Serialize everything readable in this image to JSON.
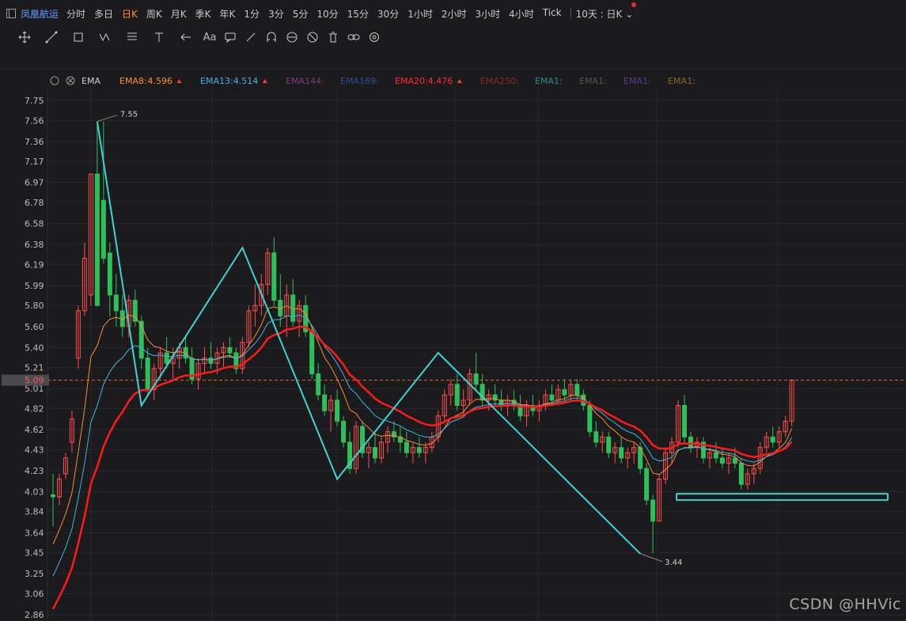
{
  "header": {
    "stock_name": "凤凰航运",
    "periods": [
      "分时",
      "多日",
      "日K",
      "周K",
      "月K",
      "季K",
      "年K",
      "1分",
      "3分",
      "5分",
      "10分",
      "15分",
      "30分",
      "1小时",
      "2小时",
      "3小时",
      "4小时",
      "Tick"
    ],
    "active_period": "日K",
    "multi_chart": "10天 : 日K"
  },
  "toolbar": {
    "tools": [
      "move-icon",
      "line-icon",
      "rect-icon",
      "wave-icon",
      "fib-icon",
      "price-line-icon",
      "arrow-icon",
      "text-icon",
      "comment-icon",
      "ray-icon",
      "magnet-icon",
      "lock-icon",
      "hide-icon",
      "trash-icon",
      "link-icon",
      "settings-icon"
    ],
    "text_tool_label": "Aa"
  },
  "indicator": {
    "name": "EMA",
    "items": [
      {
        "label": "EMA8:",
        "value": "4.596",
        "color": "#ff8c2e",
        "up": true
      },
      {
        "label": "EMA13:",
        "value": "4.514",
        "color": "#3fb4e6",
        "up": true
      },
      {
        "label": "EMA144:",
        "value": "",
        "color": "#7a3a7a",
        "up": false
      },
      {
        "label": "EMA169:",
        "value": "",
        "color": "#2b4f8f",
        "up": false
      },
      {
        "label": "EMA20:",
        "value": "4.476",
        "color": "#ff2a2a",
        "up": true
      },
      {
        "label": "EMA250:",
        "value": "",
        "color": "#8a2a2a",
        "up": false
      },
      {
        "label": "EMA1:",
        "value": "",
        "color": "#2a8a8a",
        "up": false
      },
      {
        "label": "EMA1:",
        "value": "",
        "color": "#555555",
        "up": false
      },
      {
        "label": "EMA1:",
        "value": "",
        "color": "#5a3a8a",
        "up": false
      },
      {
        "label": "EMA1:",
        "value": "",
        "color": "#8a6a2a",
        "up": false
      }
    ]
  },
  "price_axis": {
    "ticks": [
      "7.75",
      "7.56",
      "7.36",
      "7.17",
      "6.97",
      "6.78",
      "6.58",
      "6.38",
      "6.19",
      "5.99",
      "5.80",
      "5.60",
      "5.40",
      "5.21",
      "5.01",
      "4.82",
      "4.62",
      "4.43",
      "4.23",
      "4.03",
      "3.84",
      "3.64",
      "3.45",
      "3.25",
      "3.06",
      "2.86"
    ],
    "current_price": "5.09",
    "ylim": [
      2.86,
      7.75
    ]
  },
  "annotations": {
    "high_label": "7.55",
    "low_label": "3.44"
  },
  "chart_data": {
    "type": "candlestick",
    "ylim": [
      2.86,
      7.75
    ],
    "current_price": 5.09,
    "candles": [
      [
        4.0,
        4.2,
        3.7,
        3.98
      ],
      [
        3.98,
        4.2,
        3.9,
        4.15
      ],
      [
        4.2,
        4.4,
        4.15,
        4.35
      ],
      [
        4.5,
        4.8,
        4.4,
        4.72
      ],
      [
        5.3,
        5.8,
        5.2,
        5.75
      ],
      [
        5.75,
        6.4,
        5.7,
        6.25
      ],
      [
        5.9,
        7.05,
        5.8,
        7.05
      ],
      [
        7.05,
        7.55,
        5.8,
        5.8
      ],
      [
        6.8,
        7.55,
        6.2,
        6.25
      ],
      [
        6.3,
        6.4,
        5.7,
        5.9
      ],
      [
        5.9,
        6.1,
        5.6,
        5.75
      ],
      [
        5.75,
        5.9,
        5.5,
        5.6
      ],
      [
        5.6,
        5.9,
        5.5,
        5.85
      ],
      [
        5.85,
        5.95,
        5.6,
        5.65
      ],
      [
        5.65,
        5.7,
        5.2,
        5.3
      ],
      [
        5.3,
        5.4,
        4.95,
        5.0
      ],
      [
        5.0,
        5.25,
        4.9,
        5.2
      ],
      [
        5.2,
        5.4,
        5.1,
        5.35
      ],
      [
        5.35,
        5.5,
        5.2,
        5.25
      ],
      [
        5.25,
        5.4,
        5.1,
        5.3
      ],
      [
        5.3,
        5.45,
        5.2,
        5.4
      ],
      [
        5.4,
        5.5,
        5.25,
        5.3
      ],
      [
        5.3,
        5.4,
        5.05,
        5.1
      ],
      [
        5.1,
        5.3,
        5.0,
        5.25
      ],
      [
        5.25,
        5.4,
        5.15,
        5.3
      ],
      [
        5.3,
        5.45,
        5.2,
        5.25
      ],
      [
        5.25,
        5.4,
        5.15,
        5.35
      ],
      [
        5.35,
        5.45,
        5.2,
        5.4
      ],
      [
        5.4,
        5.5,
        5.3,
        5.35
      ],
      [
        5.35,
        5.4,
        5.15,
        5.2
      ],
      [
        5.2,
        5.5,
        5.15,
        5.45
      ],
      [
        5.45,
        5.8,
        5.4,
        5.75
      ],
      [
        5.75,
        6.0,
        5.6,
        5.8
      ],
      [
        5.8,
        6.1,
        5.7,
        6.0
      ],
      [
        6.0,
        6.35,
        5.9,
        6.3
      ],
      [
        6.3,
        6.45,
        5.8,
        5.85
      ],
      [
        5.85,
        6.1,
        5.6,
        5.7
      ],
      [
        5.7,
        6.0,
        5.5,
        5.9
      ],
      [
        5.9,
        6.05,
        5.6,
        5.65
      ],
      [
        5.65,
        5.85,
        5.5,
        5.8
      ],
      [
        5.8,
        5.9,
        5.5,
        5.55
      ],
      [
        5.55,
        5.6,
        5.1,
        5.15
      ],
      [
        5.15,
        5.25,
        4.9,
        4.95
      ],
      [
        4.95,
        5.05,
        4.75,
        4.8
      ],
      [
        4.8,
        4.95,
        4.6,
        4.9
      ],
      [
        4.9,
        5.0,
        4.65,
        4.7
      ],
      [
        4.7,
        4.75,
        4.45,
        4.5
      ],
      [
        4.5,
        4.6,
        4.2,
        4.25
      ],
      [
        4.25,
        4.7,
        4.2,
        4.65
      ],
      [
        4.65,
        4.7,
        4.35,
        4.4
      ],
      [
        4.4,
        4.5,
        4.25,
        4.45
      ],
      [
        4.45,
        4.6,
        4.3,
        4.35
      ],
      [
        4.35,
        4.55,
        4.3,
        4.5
      ],
      [
        4.5,
        4.65,
        4.4,
        4.6
      ],
      [
        4.6,
        4.7,
        4.5,
        4.55
      ],
      [
        4.55,
        4.65,
        4.4,
        4.5
      ],
      [
        4.5,
        4.6,
        4.35,
        4.4
      ],
      [
        4.4,
        4.5,
        4.3,
        4.45
      ],
      [
        4.45,
        4.55,
        4.35,
        4.4
      ],
      [
        4.4,
        4.5,
        4.3,
        4.45
      ],
      [
        4.45,
        4.6,
        4.4,
        4.55
      ],
      [
        4.55,
        4.8,
        4.5,
        4.75
      ],
      [
        4.75,
        5.0,
        4.7,
        4.95
      ],
      [
        4.95,
        5.1,
        4.85,
        5.05
      ],
      [
        5.05,
        5.15,
        4.8,
        4.85
      ],
      [
        4.85,
        5.0,
        4.75,
        4.9
      ],
      [
        4.9,
        5.2,
        4.85,
        5.15
      ],
      [
        5.15,
        5.35,
        5.0,
        5.05
      ],
      [
        5.05,
        5.15,
        4.85,
        4.9
      ],
      [
        4.9,
        5.0,
        4.8,
        4.95
      ],
      [
        4.95,
        5.05,
        4.85,
        4.9
      ],
      [
        4.9,
        5.0,
        4.8,
        4.85
      ],
      [
        4.85,
        4.95,
        4.75,
        4.9
      ],
      [
        4.9,
        5.0,
        4.8,
        4.85
      ],
      [
        4.85,
        4.95,
        4.7,
        4.75
      ],
      [
        4.75,
        4.9,
        4.65,
        4.85
      ],
      [
        4.85,
        4.95,
        4.75,
        4.8
      ],
      [
        4.8,
        4.9,
        4.7,
        4.85
      ],
      [
        4.85,
        5.0,
        4.8,
        4.95
      ],
      [
        4.95,
        5.05,
        4.85,
        4.9
      ],
      [
        4.9,
        5.05,
        4.85,
        5.0
      ],
      [
        5.0,
        5.1,
        4.9,
        4.95
      ],
      [
        4.95,
        5.1,
        4.9,
        5.05
      ],
      [
        5.05,
        5.1,
        4.9,
        4.95
      ],
      [
        4.95,
        5.0,
        4.8,
        4.85
      ],
      [
        4.85,
        4.9,
        4.55,
        4.6
      ],
      [
        4.6,
        4.7,
        4.45,
        4.5
      ],
      [
        4.5,
        4.6,
        4.4,
        4.55
      ],
      [
        4.55,
        4.6,
        4.35,
        4.4
      ],
      [
        4.4,
        4.5,
        4.3,
        4.45
      ],
      [
        4.45,
        4.55,
        4.3,
        4.35
      ],
      [
        4.35,
        4.45,
        4.25,
        4.4
      ],
      [
        4.4,
        4.5,
        4.3,
        4.45
      ],
      [
        4.45,
        4.5,
        4.2,
        4.25
      ],
      [
        4.25,
        4.3,
        3.9,
        3.95
      ],
      [
        3.95,
        4.0,
        3.44,
        3.75
      ],
      [
        3.75,
        4.2,
        3.75,
        4.15
      ],
      [
        4.15,
        4.45,
        4.1,
        4.4
      ],
      [
        4.4,
        4.55,
        4.3,
        4.5
      ],
      [
        4.5,
        4.9,
        4.45,
        4.85
      ],
      [
        4.85,
        4.95,
        4.5,
        4.55
      ],
      [
        4.55,
        4.6,
        4.4,
        4.45
      ],
      [
        4.45,
        4.55,
        4.35,
        4.5
      ],
      [
        4.5,
        4.55,
        4.3,
        4.35
      ],
      [
        4.35,
        4.45,
        4.25,
        4.4
      ],
      [
        4.4,
        4.5,
        4.3,
        4.35
      ],
      [
        4.35,
        4.45,
        4.25,
        4.3
      ],
      [
        4.3,
        4.4,
        4.2,
        4.35
      ],
      [
        4.35,
        4.45,
        4.25,
        4.3
      ],
      [
        4.3,
        4.35,
        4.05,
        4.1
      ],
      [
        4.1,
        4.25,
        4.05,
        4.2
      ],
      [
        4.2,
        4.3,
        4.1,
        4.25
      ],
      [
        4.25,
        4.5,
        4.2,
        4.45
      ],
      [
        4.45,
        4.6,
        4.4,
        4.55
      ],
      [
        4.55,
        4.65,
        4.45,
        4.5
      ],
      [
        4.5,
        4.65,
        4.45,
        4.6
      ],
      [
        4.6,
        4.75,
        4.55,
        4.7
      ],
      [
        4.7,
        5.1,
        4.65,
        5.09
      ]
    ],
    "series": [
      {
        "name": "EMA8",
        "color": "#ff8c2e"
      },
      {
        "name": "EMA13",
        "color": "#3fb4e6"
      },
      {
        "name": "EMA20",
        "color": "#ff2a2a"
      }
    ],
    "zigzag": [
      [
        7,
        7.55
      ],
      [
        14,
        4.85
      ],
      [
        30,
        6.35
      ],
      [
        45,
        4.15
      ],
      [
        61,
        5.35
      ],
      [
        93,
        3.44
      ]
    ],
    "support_zone": [
      3.95,
      4.01
    ]
  }
}
